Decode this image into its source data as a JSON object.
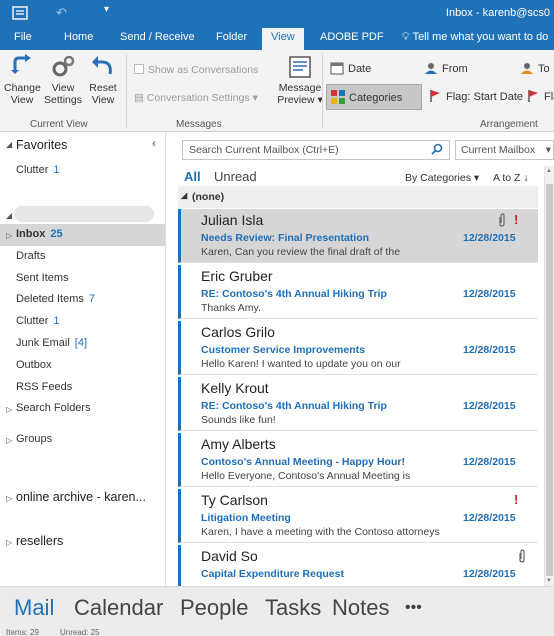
{
  "window": {
    "title": "Inbox - karenb@scs0"
  },
  "ribbon_tabs": [
    "File",
    "Home",
    "Send / Receive",
    "Folder",
    "View",
    "ADOBE PDF"
  ],
  "tell_me": "Tell me what you want to do",
  "ribbon": {
    "current_view": {
      "change_view": [
        "Change",
        "View"
      ],
      "view_settings": [
        "View",
        "Settings"
      ],
      "reset_view": [
        "Reset",
        "View"
      ],
      "label": "Current View"
    },
    "messages": {
      "show_conversations": "Show as Conversations",
      "conversation_settings": "Conversation Settings",
      "message_preview": [
        "Message",
        "Preview"
      ],
      "label": "Messages"
    },
    "arrangement": {
      "items": [
        "Date",
        "From",
        "To",
        "Categories",
        "Flag: Start Date",
        "Fla"
      ],
      "selected": "Categories",
      "label": "Arrangement"
    }
  },
  "folders": {
    "favorites_label": "Favorites",
    "favorites": [
      {
        "name": "Clutter",
        "count": "1"
      }
    ],
    "mailbox": [
      {
        "name": "Inbox",
        "count": "25"
      },
      {
        "name": "Drafts",
        "count": ""
      },
      {
        "name": "Sent Items",
        "count": ""
      },
      {
        "name": "Deleted Items",
        "count": "7"
      },
      {
        "name": "Clutter",
        "count": "1"
      },
      {
        "name": "Junk Email",
        "count": "[4]"
      },
      {
        "name": "Outbox",
        "count": ""
      },
      {
        "name": "RSS Feeds",
        "count": ""
      },
      {
        "name": "Search Folders",
        "count": ""
      }
    ],
    "groups": "Groups",
    "online_archive": "online archive - karen...",
    "resellers": "resellers"
  },
  "search": {
    "placeholder": "Search Current Mailbox (Ctrl+E)",
    "scope": "Current Mailbox"
  },
  "list": {
    "filter_all": "All",
    "filter_unread": "Unread",
    "sort_by": "By Categories",
    "order": "A to Z",
    "group": "(none)",
    "messages": [
      {
        "from": "Julian Isla",
        "subject": "Needs Review: Final Presentation",
        "preview": "Karen,  Can you review the final draft of the",
        "date": "12/28/2015",
        "flag": "!",
        "attachment": true
      },
      {
        "from": "Eric Gruber",
        "subject": "RE: Contoso's 4th Annual Hiking Trip",
        "preview": "Thanks Amy.",
        "date": "12/28/2015",
        "flag": "",
        "attachment": false
      },
      {
        "from": "Carlos Grilo",
        "subject": "Customer Service Improvements",
        "preview": "Hello Karen!  I wanted to update you on our",
        "date": "12/28/2015",
        "flag": "",
        "attachment": false
      },
      {
        "from": "Kelly Krout",
        "subject": "RE: Contoso's 4th Annual Hiking Trip",
        "preview": "Sounds like fun!",
        "date": "12/28/2015",
        "flag": "",
        "attachment": false
      },
      {
        "from": "Amy Alberts",
        "subject": "Contoso's Annual Meeting - Happy Hour!",
        "preview": "Hello Everyone,  Contoso's Annual Meeting is",
        "date": "12/28/2015",
        "flag": "",
        "attachment": false
      },
      {
        "from": "Ty Carlson",
        "subject": "Litigation Meeting",
        "preview": "Karen,  I have a meeting with the Contoso attorneys",
        "date": "12/28/2015",
        "flag": "!",
        "attachment": false
      },
      {
        "from": "David So",
        "subject": "Capital Expenditure Request",
        "preview": "",
        "date": "12/28/2015",
        "flag": "",
        "attachment": true
      }
    ]
  },
  "nav": [
    "Mail",
    "Calendar",
    "People",
    "Tasks",
    "Notes",
    "•••"
  ],
  "status": {
    "items": "Items: 29",
    "unread": "Unread: 25"
  },
  "colors": {
    "accent": "#2072b8",
    "flag": "#d02020",
    "selected_row": "#d6d6d6"
  }
}
